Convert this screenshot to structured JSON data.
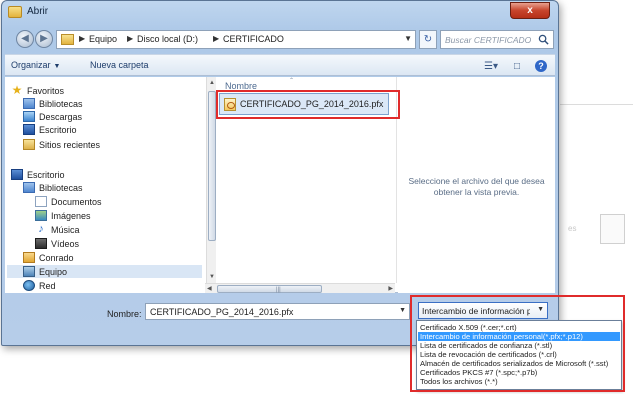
{
  "window": {
    "title": "Abrir",
    "close_label": "x"
  },
  "address_bar": {
    "crumbs": [
      "Equipo",
      "Disco local (D:)",
      "CERTIFICADO"
    ],
    "search_placeholder": "Buscar CERTIFICADO"
  },
  "toolbar": {
    "organize_label": "Organizar",
    "new_folder_label": "Nueva carpeta"
  },
  "nav_pane": {
    "items": [
      {
        "label": "Favoritos",
        "icon": "star-icon"
      },
      {
        "label": "Bibliotecas",
        "icon": "library-icon"
      },
      {
        "label": "Descargas",
        "icon": "downloads-icon"
      },
      {
        "label": "Escritorio",
        "icon": "desktop-icon"
      },
      {
        "label": "Sitios recientes",
        "icon": "recent-places-icon"
      },
      {
        "label": "Escritorio",
        "icon": "desktop-icon"
      },
      {
        "label": "Bibliotecas",
        "icon": "library-icon"
      },
      {
        "label": "Documentos",
        "icon": "documents-icon"
      },
      {
        "label": "Imágenes",
        "icon": "pictures-icon"
      },
      {
        "label": "Música",
        "icon": "music-icon"
      },
      {
        "label": "Vídeos",
        "icon": "videos-icon"
      },
      {
        "label": "Conrado",
        "icon": "user-folder-icon"
      },
      {
        "label": "Equipo",
        "icon": "computer-icon",
        "selected": true
      },
      {
        "label": "Red",
        "icon": "network-icon"
      }
    ]
  },
  "file_list": {
    "column_header": "Nombre",
    "files": [
      {
        "name": "CERTIFICADO_PG_2014_2016.pfx",
        "icon": "pfx-file-icon",
        "selected": true
      }
    ]
  },
  "preview": {
    "text": "Seleccione el archivo del que desea obtener la vista previa."
  },
  "filename": {
    "label": "Nombre:",
    "value": "CERTIFICADO_PG_2014_2016.pfx"
  },
  "file_type": {
    "selected": "Intercambio de información pe",
    "options": [
      "Certificado X.509 (*.cer;*.crt)",
      "Intercambio de información personal(*.pfx;*.p12)",
      "Lista de certificados de confianza (*.stl)",
      "Lista de revocación de certificados (*.crl)",
      "Almacén de certificados serializados de Microsoft (*.sst)",
      "Certificados PKCS #7 (*.spc;*.p7b)",
      "Todos los archivos (*.*)"
    ],
    "highlighted_index": 1
  }
}
